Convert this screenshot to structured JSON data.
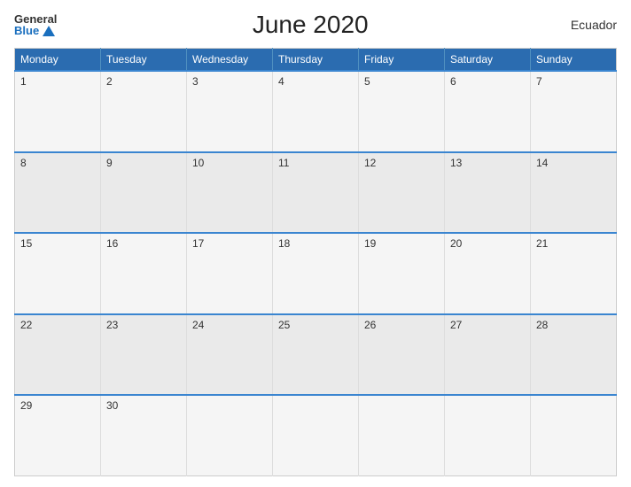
{
  "header": {
    "logo_general": "General",
    "logo_blue": "Blue",
    "title": "June 2020",
    "country": "Ecuador"
  },
  "weekdays": [
    "Monday",
    "Tuesday",
    "Wednesday",
    "Thursday",
    "Friday",
    "Saturday",
    "Sunday"
  ],
  "weeks": [
    [
      "1",
      "2",
      "3",
      "4",
      "5",
      "6",
      "7"
    ],
    [
      "8",
      "9",
      "10",
      "11",
      "12",
      "13",
      "14"
    ],
    [
      "15",
      "16",
      "17",
      "18",
      "19",
      "20",
      "21"
    ],
    [
      "22",
      "23",
      "24",
      "25",
      "26",
      "27",
      "28"
    ],
    [
      "29",
      "30",
      "",
      "",
      "",
      "",
      ""
    ]
  ]
}
